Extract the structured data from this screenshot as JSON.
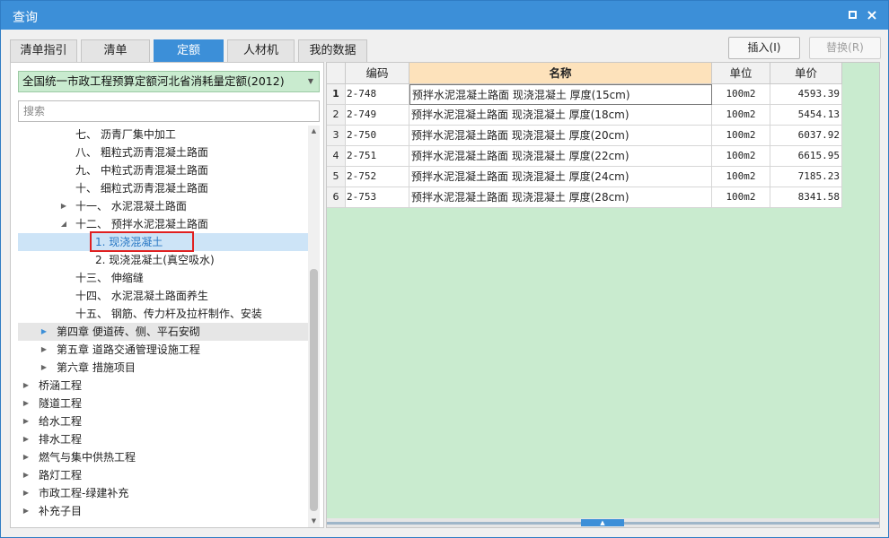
{
  "window": {
    "title": "查询",
    "maximize_label": "",
    "close_label": "×"
  },
  "tabs": [
    {
      "label": "清单指引"
    },
    {
      "label": "清单"
    },
    {
      "label": "定额",
      "active": true
    },
    {
      "label": "人材机"
    },
    {
      "label": "我的数据"
    }
  ],
  "toolbar": {
    "insert_label": "插入(I)",
    "replace_label": "替换(R)"
  },
  "library": {
    "selected": "全国统一市政工程预算定额河北省消耗量定额(2012)"
  },
  "search": {
    "placeholder": "搜索",
    "value": ""
  },
  "tree": [
    {
      "label": "七、 沥青厂集中加工",
      "toggle": ""
    },
    {
      "label": "八、 粗粒式沥青混凝土路面",
      "toggle": ""
    },
    {
      "label": "九、 中粒式沥青混凝土路面",
      "toggle": ""
    },
    {
      "label": "十、 细粒式沥青混凝土路面",
      "toggle": ""
    },
    {
      "label": "十一、 水泥混凝土路面",
      "toggle": "▶"
    },
    {
      "label": "十二、 预拌水泥混凝土路面",
      "toggle": "◢"
    },
    {
      "label": "1. 现浇混凝土",
      "toggle": "",
      "selected": true
    },
    {
      "label": "2. 现浇混凝土(真空吸水)",
      "toggle": ""
    },
    {
      "label": "十三、 伸缩缝",
      "toggle": ""
    },
    {
      "label": "十四、 水泥混凝土路面养生",
      "toggle": ""
    },
    {
      "label": "十五、 钢筋、传力杆及拉杆制作、安装",
      "toggle": ""
    },
    {
      "label": "第四章 便道砖、侧、平石安砌",
      "toggle": "▶"
    },
    {
      "label": "第五章 道路交通管理设施工程",
      "toggle": "▶"
    },
    {
      "label": "第六章 措施项目",
      "toggle": "▶"
    },
    {
      "label": "桥涵工程",
      "toggle": "▶"
    },
    {
      "label": "隧道工程",
      "toggle": "▶"
    },
    {
      "label": "给水工程",
      "toggle": "▶"
    },
    {
      "label": "排水工程",
      "toggle": "▶"
    },
    {
      "label": "燃气与集中供热工程",
      "toggle": "▶"
    },
    {
      "label": "路灯工程",
      "toggle": "▶"
    },
    {
      "label": "市政工程-绿建补充",
      "toggle": "▶"
    },
    {
      "label": "补充子目",
      "toggle": "▶"
    }
  ],
  "grid": {
    "columns": [
      "",
      "编码",
      "名称",
      "单位",
      "单价"
    ],
    "rows": [
      [
        "1",
        "2-748",
        "预拌水泥混凝土路面 现浇混凝土 厚度(15cm)",
        "100m2",
        "4593.39"
      ],
      [
        "2",
        "2-749",
        "预拌水泥混凝土路面 现浇混凝土 厚度(18cm)",
        "100m2",
        "5454.13"
      ],
      [
        "3",
        "2-750",
        "预拌水泥混凝土路面 现浇混凝土 厚度(20cm)",
        "100m2",
        "6037.92"
      ],
      [
        "4",
        "2-751",
        "预拌水泥混凝土路面 现浇混凝土 厚度(22cm)",
        "100m2",
        "6615.95"
      ],
      [
        "5",
        "2-752",
        "预拌水泥混凝土路面 现浇混凝土 厚度(24cm)",
        "100m2",
        "7185.23"
      ],
      [
        "6",
        "2-753",
        "预拌水泥混凝土路面 现浇混凝土 厚度(28cm)",
        "100m2",
        "8341.58"
      ]
    ]
  },
  "colors": {
    "accent": "#3c8fd8",
    "grid_bg": "#c9ebcf",
    "name_header": "#fde2bb",
    "selection_outline": "#e02020"
  }
}
